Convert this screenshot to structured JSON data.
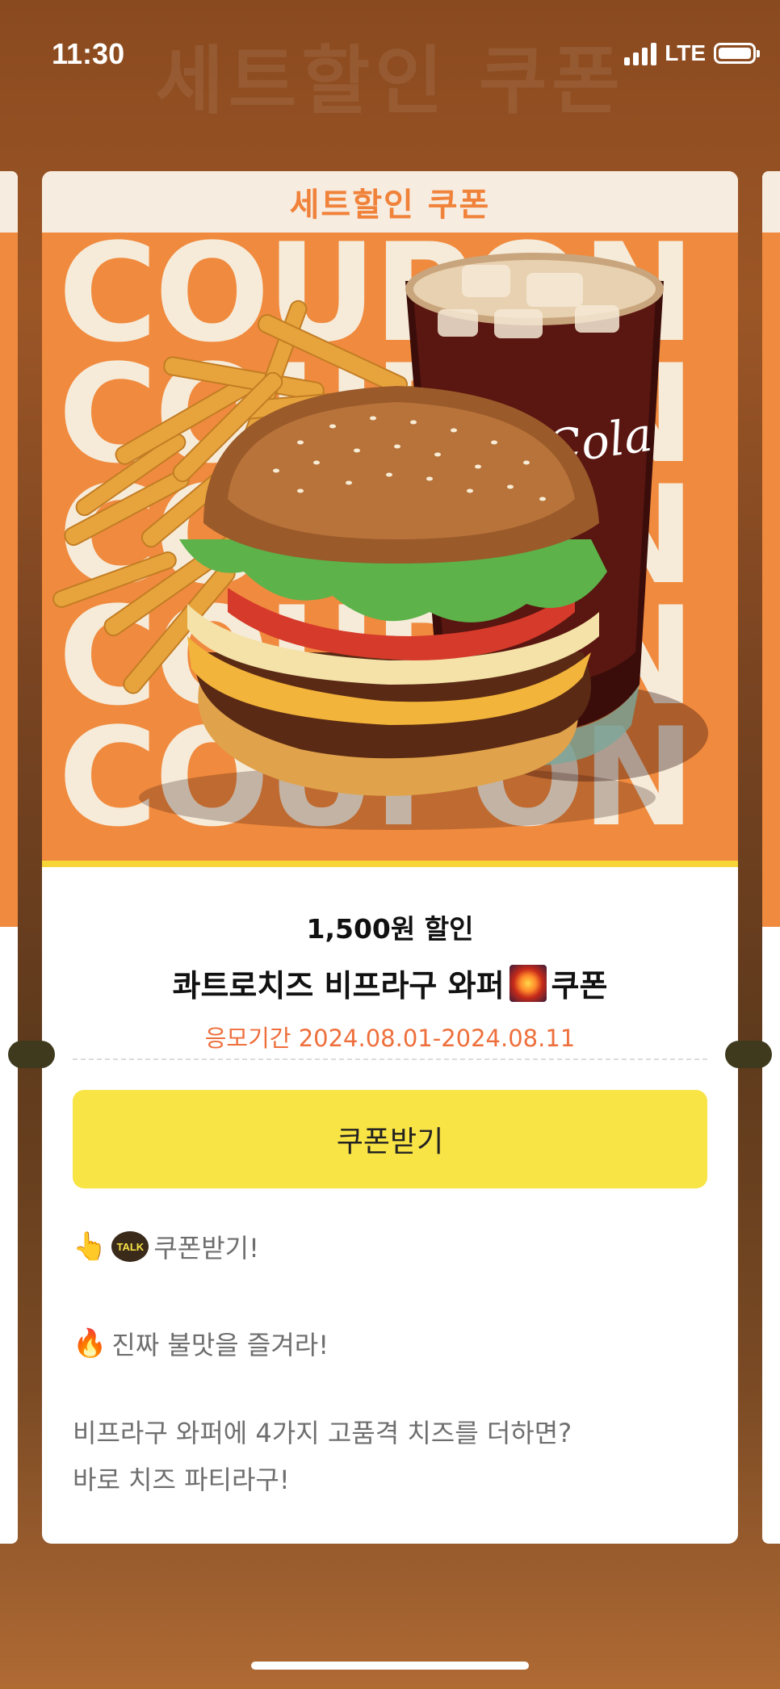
{
  "status_bar": {
    "time": "11:30",
    "network": "LTE"
  },
  "background": {
    "blurred_title": "세트할인 쿠폰"
  },
  "coupon": {
    "header_title": "세트할인 쿠폰",
    "hero_word": "COUPON",
    "hero_image_icon": "burger-fries-cola-illustration",
    "brand_on_cup": "Coca-Cola",
    "discount_text": "1,500원 할인",
    "product_name_before_icon": "콰트로치즈 비프라구 와퍼",
    "product_name_icon": "firework-icon",
    "product_name_after_icon": "쿠폰",
    "period_label": "응모기간",
    "period_value": "2024.08.01-2024.08.11",
    "button_label": "쿠폰받기",
    "accent_color": "#f08a3e",
    "button_color": "#f9e445"
  },
  "description": {
    "line1_text": "쿠폰받기!",
    "talk_badge": "TALK",
    "line2_text": "진짜 불맛을 즐겨라!",
    "line3_text": "비프라구 와퍼에 4가지 고품격 치즈를 더하면?",
    "line4_text": "바로 치즈 파티라구!"
  }
}
